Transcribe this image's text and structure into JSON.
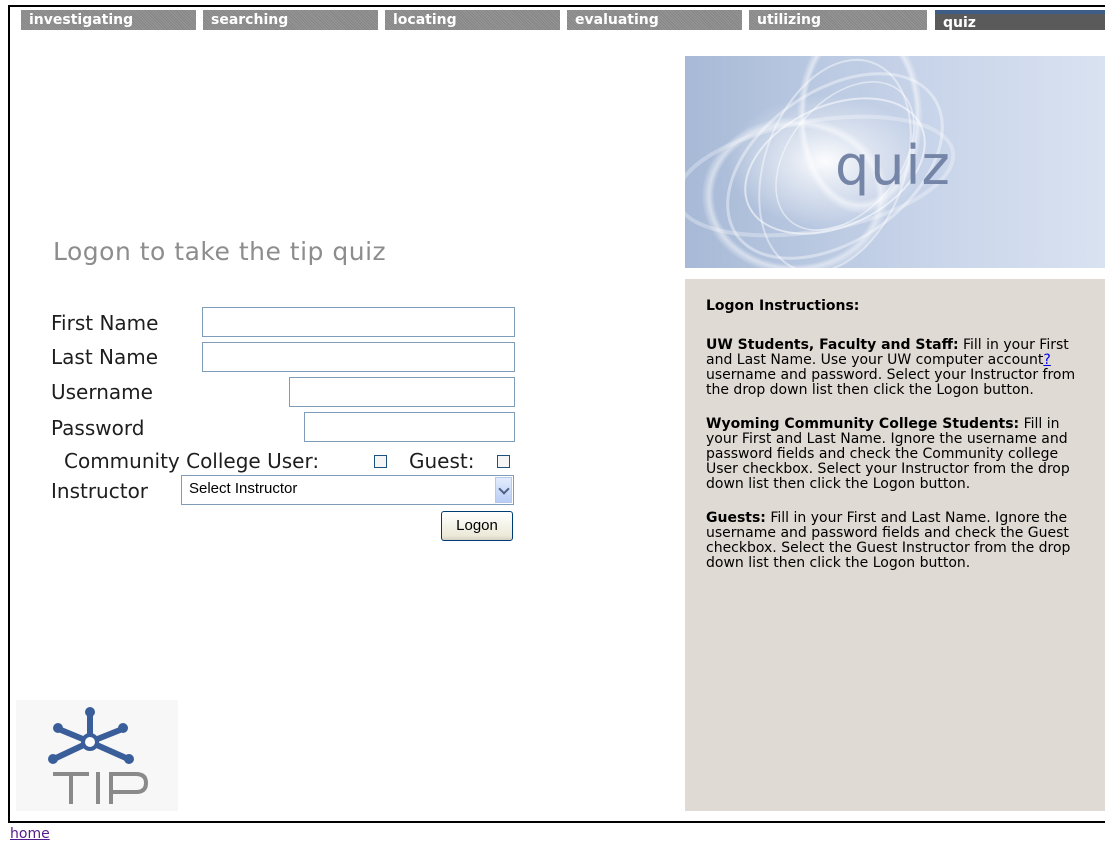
{
  "nav": {
    "items": [
      {
        "label": "investigating"
      },
      {
        "label": "searching"
      },
      {
        "label": "locating"
      },
      {
        "label": "evaluating"
      },
      {
        "label": "utilizing"
      },
      {
        "label": "quiz",
        "active": true
      }
    ]
  },
  "header_art": {
    "word": "quiz"
  },
  "form": {
    "title": "Logon to take the tip quiz",
    "first_name_label": "First Name",
    "last_name_label": "Last Name",
    "username_label": "Username",
    "password_label": "Password",
    "first_name_value": "",
    "last_name_value": "",
    "username_value": "",
    "password_value": "",
    "community_college_label": "Community College User:",
    "community_college_checked": false,
    "guest_label": "Guest:",
    "guest_checked": false,
    "instructor_label": "Instructor",
    "instructor_selected": "Select Instructor",
    "logon_button": "Logon"
  },
  "instructions": {
    "heading": "Logon Instructions:",
    "uw_title": "UW Students, Faculty and Staff:",
    "uw_text_1": " Fill in your First and Last Name. Use your UW computer account",
    "uw_help_link": "?",
    "uw_text_2": " username and password. Select your Instructor from the drop down list then click the Logon button.",
    "wcc_title": "Wyoming Community College Students:",
    "wcc_text": " Fill in your First and Last Name. Ignore the username and password fields and check the Community college User checkbox. Select your Instructor from the drop down list then click the Logon button.",
    "guest_title": "Guests:",
    "guest_text": " Fill in your First and Last Name. Ignore the username and password fields and check the Guest checkbox. Select the Guest Instructor from the drop down list then click the Logon button."
  },
  "logo": {
    "text": "TIP",
    "icon": "tip-star-icon"
  },
  "footer": {
    "home_link": "home"
  },
  "colors": {
    "nav_bg": "#8c8c8c",
    "nav_active_bg": "#5a5a5a",
    "nav_active_accent": "#3d5d86",
    "instructions_bg": "#dfdad3",
    "logo_blue": "#3a5e9a",
    "logo_grey": "#8a8a8a",
    "link": "#0000ee",
    "visited_link": "#551a8b"
  }
}
